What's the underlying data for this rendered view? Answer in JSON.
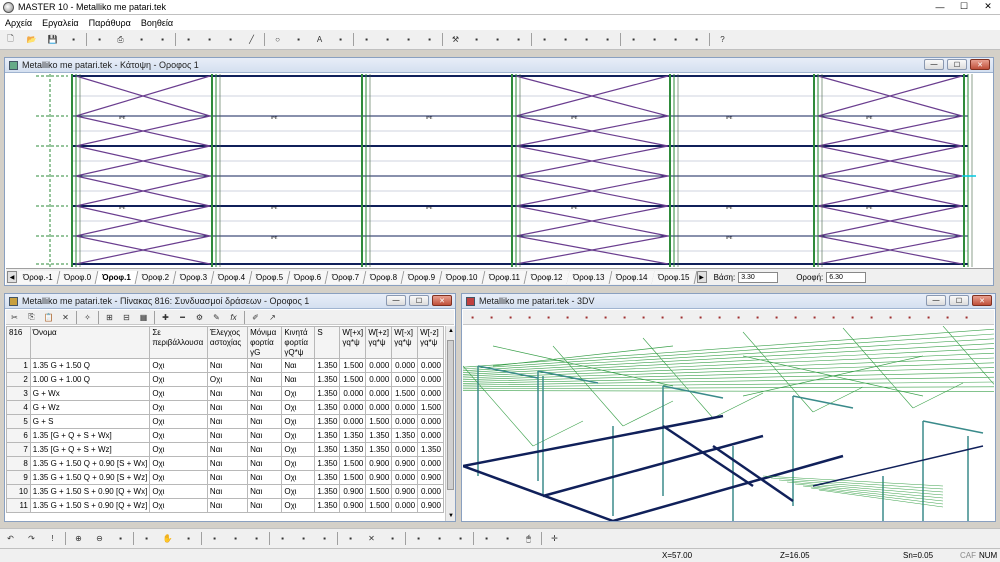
{
  "app": {
    "title": "MASTER 10 - Metalliko me patari.tek",
    "window_buttons": {
      "minimize": "—",
      "maximize": "☐",
      "close": "✕"
    }
  },
  "menu": [
    "Αρχεία",
    "Εργαλεία",
    "Παράθυρα",
    "Βοηθεία"
  ],
  "plan_window": {
    "title": "Metalliko me patari.tek - Κάτοψη - Οροφος 1",
    "member_tag": "IPE",
    "floor_tabs": [
      "Όροφ.-1",
      "Όροφ.0",
      "Όροφ.1",
      "Όροφ.2",
      "Όροφ.3",
      "Όροφ.4",
      "Όροφ.5",
      "Όροφ.6",
      "Όροφ.7",
      "Όροφ.8",
      "Όροφ.9",
      "Όροφ.10",
      "Όροφ.11",
      "Όροφ.12",
      "Όροφ.13",
      "Όροφ.14",
      "Όροφ.15"
    ],
    "active_floor_index": 2,
    "base_label": "Βάση:",
    "base_value": "3.30",
    "ceiling_label": "Οροφή:",
    "ceiling_value": "6.30"
  },
  "table_window": {
    "title": "Metalliko me patari.tek - Πίνακας 816: Συνδυασμοί δράσεων - Οροφος 1",
    "columns": [
      "816",
      "Όνομα",
      "Σε περιβάλλουσα",
      "Έλεγχος αστοχίας",
      "Μόνιμα φορτία γG",
      "Κινητά φορτία γQ*ψ",
      "S",
      "W[+x] γq*ψ",
      "W[+z] γq*ψ",
      "W[-x] γq*ψ",
      "W[-z] γq*ψ"
    ],
    "rows": [
      [
        "1",
        "1.35 G + 1.50 Q",
        "Οχι",
        "Ναι",
        "Ναι",
        "Ναι",
        "1.350",
        "1.500",
        "0.000",
        "0.000",
        "0.000"
      ],
      [
        "2",
        "1.00 G + 1.00 Q",
        "Οχι",
        "Οχι",
        "Ναι",
        "Ναι",
        "1.350",
        "1.500",
        "0.000",
        "0.000",
        "0.000"
      ],
      [
        "3",
        "G + Wx",
        "Οχι",
        "Ναι",
        "Ναι",
        "Οχι",
        "1.350",
        "0.000",
        "0.000",
        "1.500",
        "0.000"
      ],
      [
        "4",
        "G + Wz",
        "Οχι",
        "Ναι",
        "Ναι",
        "Οχι",
        "1.350",
        "0.000",
        "0.000",
        "0.000",
        "1.500"
      ],
      [
        "5",
        "G + S",
        "Οχι",
        "Ναι",
        "Ναι",
        "Οχι",
        "1.350",
        "0.000",
        "1.500",
        "0.000",
        "0.000"
      ],
      [
        "6",
        "1.35 [G + Q + S + Wx]",
        "Οχι",
        "Ναι",
        "Ναι",
        "Οχι",
        "1.350",
        "1.350",
        "1.350",
        "1.350",
        "0.000"
      ],
      [
        "7",
        "1.35 [G + Q + S + Wz]",
        "Οχι",
        "Ναι",
        "Ναι",
        "Οχι",
        "1.350",
        "1.350",
        "1.350",
        "0.000",
        "1.350"
      ],
      [
        "8",
        "1.35 G + 1.50 Q + 0.90 [S + Wx]",
        "Οχι",
        "Ναι",
        "Ναι",
        "Οχι",
        "1.350",
        "1.500",
        "0.900",
        "0.900",
        "0.000"
      ],
      [
        "9",
        "1.35 G + 1.50 Q + 0.90 [S + Wz]",
        "Οχι",
        "Ναι",
        "Ναι",
        "Οχι",
        "1.350",
        "1.500",
        "0.900",
        "0.000",
        "0.900"
      ],
      [
        "10",
        "1.35 G + 1.50 S + 0.90 [Q + Wx]",
        "Οχι",
        "Ναι",
        "Ναι",
        "Οχι",
        "1.350",
        "0.900",
        "1.500",
        "0.900",
        "0.000"
      ],
      [
        "11",
        "1.35 G + 1.50 S + 0.90 [Q + Wz]",
        "Οχι",
        "Ναι",
        "Ναι",
        "Οχι",
        "1.350",
        "0.900",
        "1.500",
        "0.000",
        "0.900"
      ]
    ]
  },
  "view3d_window": {
    "title": "Metalliko me patari.tek - 3DV"
  },
  "status": {
    "x": "X=57.00",
    "z": "Z=16.05",
    "sn": "Sn=0.05",
    "caf": "CAF",
    "num": "NUM"
  },
  "colors": {
    "column_green": "#2e8b3a",
    "bracing_purple": "#6a3d8f",
    "beam_navy": "#10205a",
    "frame_teal": "#3a8a8a",
    "roof_green": "#3aa04a",
    "mdi_title": "#d4e0f0"
  },
  "icons": {
    "main_toolbar": [
      "new-icon",
      "open-icon",
      "save-icon",
      "frame-icon",
      "copy-icon",
      "print-icon",
      "print-preview-icon",
      "layers-icon",
      "pen-icon",
      "ruler-icon",
      "grid-icon",
      "line-icon",
      "circle-icon",
      "arc-icon",
      "text-icon",
      "dim-icon",
      "beam-icon",
      "column-icon",
      "slab-icon",
      "load-icon",
      "tools-icon",
      "view-icon",
      "section-icon",
      "wall-icon",
      "footing-icon",
      "stair-icon",
      "calc-icon",
      "check-icon",
      "results-icon",
      "design-icon",
      "report-icon",
      "table-icon",
      "help-icon"
    ],
    "bottom_toolbar": [
      "undo-icon",
      "redo-icon",
      "pointer-icon",
      "zoom-in-icon",
      "zoom-out-icon",
      "zoom-window-icon",
      "zoom-all-icon",
      "pan-icon",
      "redraw-icon",
      "snap-icon",
      "ortho-icon",
      "select-icon",
      "move-icon",
      "rotate-icon",
      "mirror-icon",
      "array-icon",
      "erase-icon",
      "trim-icon",
      "extend-icon",
      "offset-icon",
      "break-icon",
      "join-icon",
      "attrib-icon",
      "mouse-icon",
      "cross-icon"
    ]
  }
}
